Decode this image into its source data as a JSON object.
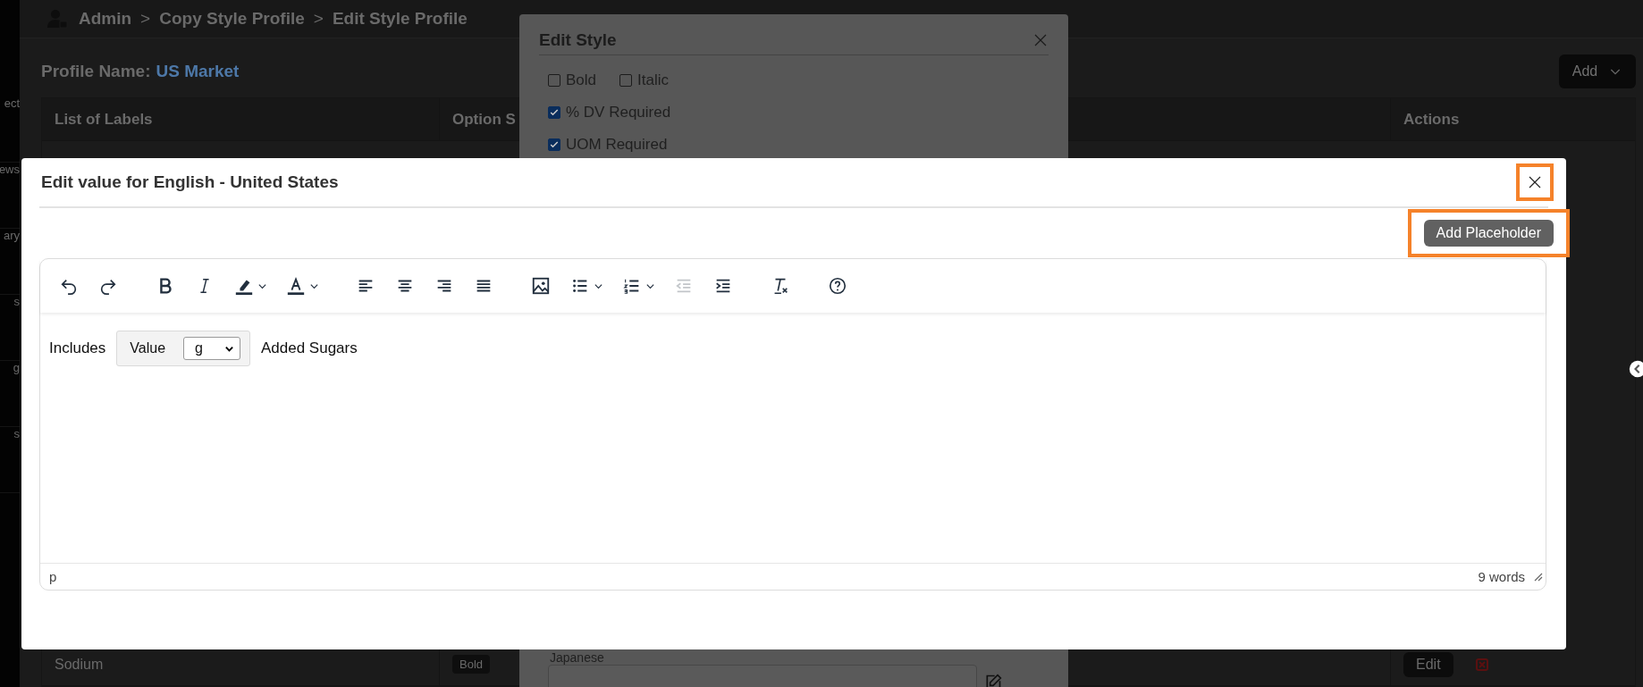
{
  "sidebar": {
    "items": [
      {
        "label": "ect"
      },
      {
        "label": "ews"
      },
      {
        "label": "ary"
      },
      {
        "label": "s"
      },
      {
        "label": "g"
      },
      {
        "label": "s"
      }
    ]
  },
  "header": {
    "breadcrumb": [
      {
        "kind": "crumb",
        "label": "Admin"
      },
      {
        "kind": "separator",
        "label": ">"
      },
      {
        "kind": "crumb",
        "label": "Copy Style Profile"
      },
      {
        "kind": "separator",
        "label": ">"
      },
      {
        "kind": "crumb",
        "label": "Edit Style Profile"
      }
    ]
  },
  "profile": {
    "label": "Profile Name:",
    "value": "US Market"
  },
  "add_button": {
    "label": "Add"
  },
  "table": {
    "columns": [
      "List of Labels",
      "Option S",
      "Actions"
    ],
    "rows": [
      {
        "cells": [
          "Sodium",
          "Bold"
        ],
        "action": "Edit"
      }
    ]
  },
  "style_dialog": {
    "title": "Edit Style",
    "options": [
      {
        "label": "Bold",
        "checked": false
      },
      {
        "label": "Italic",
        "checked": false
      },
      {
        "label": "% DV Required",
        "checked": true
      },
      {
        "label": "UOM Required",
        "checked": true
      }
    ],
    "field_label": "Japanese"
  },
  "value_dialog": {
    "title": "Edit value for English - United States",
    "close_highlighted": true,
    "button": {
      "label": "Add Placeholder",
      "highlighted": true
    },
    "toolbar": [
      [
        {
          "kind": "undo",
          "disabled": false,
          "dropdown": false
        },
        {
          "kind": "redo",
          "disabled": false,
          "dropdown": false
        }
      ],
      [
        {
          "kind": "bold",
          "disabled": false,
          "dropdown": false
        },
        {
          "kind": "italic",
          "disabled": false,
          "dropdown": false
        },
        {
          "kind": "highlight",
          "disabled": false,
          "dropdown": true
        },
        {
          "kind": "text-color",
          "disabled": false,
          "dropdown": true
        }
      ],
      [
        {
          "kind": "align-left",
          "disabled": false,
          "dropdown": false
        },
        {
          "kind": "align-center",
          "disabled": false,
          "dropdown": false
        },
        {
          "kind": "align-right",
          "disabled": false,
          "dropdown": false
        },
        {
          "kind": "justify",
          "disabled": false,
          "dropdown": false
        }
      ],
      [
        {
          "kind": "image",
          "disabled": false,
          "dropdown": false
        },
        {
          "kind": "bullet-list",
          "disabled": false,
          "dropdown": true
        },
        {
          "kind": "numbered-list",
          "disabled": false,
          "dropdown": true
        },
        {
          "kind": "outdent",
          "disabled": true,
          "dropdown": false
        },
        {
          "kind": "indent",
          "disabled": false,
          "dropdown": false
        }
      ],
      [
        {
          "kind": "clear-format",
          "disabled": false,
          "dropdown": false
        }
      ],
      [
        {
          "kind": "help",
          "disabled": false,
          "dropdown": false
        }
      ]
    ],
    "content": {
      "before": "Includes",
      "placeholder": {
        "label": "Value",
        "unit": "g"
      },
      "after": "Added Sugars"
    },
    "status": {
      "path": "p",
      "word_count": "9 words"
    }
  }
}
